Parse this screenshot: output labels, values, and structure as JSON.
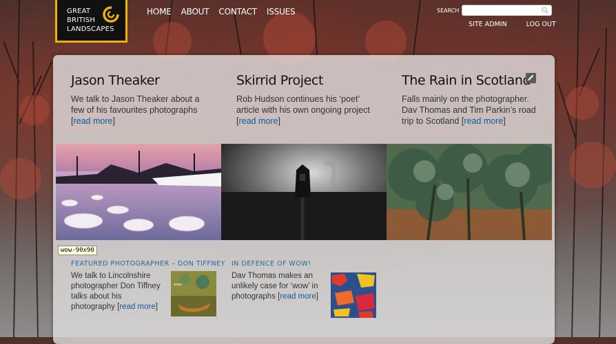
{
  "logo": {
    "line1": "GREAT",
    "line2": "BRITISH",
    "line3": "LANDSCAPES"
  },
  "nav": {
    "home": "HOME",
    "about": "ABOUT",
    "contact": "CONTACT",
    "issues": "ISSUES"
  },
  "search": {
    "label": "SEARCH",
    "placeholder": ""
  },
  "admin": {
    "site_admin": "SITE ADMIN",
    "log_out": "LOG OUT"
  },
  "features": [
    {
      "title": "Jason Theaker",
      "text": "We talk to Jason Theaker about a few of his favourites photographs",
      "link": "read more"
    },
    {
      "title": "Skirrid Project",
      "text": "Rob Hudson continues his ‘poet’ article with his own ongoing project",
      "link": "read more"
    },
    {
      "title": "The Rain in Scotland",
      "text": "Falls mainly on the photographer. Dav Thomas and Tim Parkin’s road trip to Scotland",
      "link": "read more"
    }
  ],
  "tooltip": "wow-90x90",
  "secondary": [
    {
      "title": "FEATURED PHOTOGRAPHER – DON TIFFNEY",
      "text": "We talk to Lincolnshire photographer Don Tiffney talks about his photography",
      "link": "read more"
    },
    {
      "title": "IN DEFENCE OF WOW!",
      "text": "Dav Thomas makes an unlikely case for ‘wow’ in photographs",
      "link": "read more"
    }
  ],
  "colors": {
    "accent": "#f0b400",
    "link": "#0d5b9a",
    "heading_blue": "#1f6a9a"
  },
  "icons": {
    "search": "search-icon",
    "edit": "edit-icon",
    "logo": "swirl-logo-icon"
  }
}
